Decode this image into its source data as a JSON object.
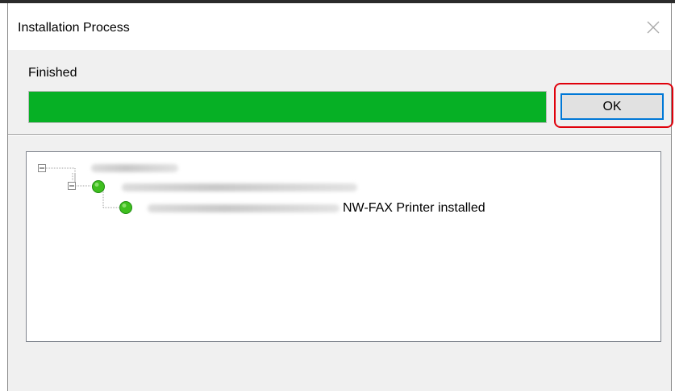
{
  "window": {
    "title": "Installation Process",
    "close_icon": "close-icon"
  },
  "status": {
    "label": "Finished",
    "progress_percent": 100,
    "progress_color": "#06b025"
  },
  "ok_button": {
    "label": "OK",
    "highlight_color": "#e0000b"
  },
  "tree": {
    "items": [
      {
        "level": 0,
        "label": "",
        "obscured": true,
        "expanded": true,
        "icon": "minus-box-icon"
      },
      {
        "level": 1,
        "label": "",
        "obscured": true,
        "expanded": true,
        "icon": "green-status-icon"
      },
      {
        "level": 2,
        "label": "",
        "obscured": true,
        "status": "NW-FAX Printer installed",
        "icon": "green-status-icon"
      }
    ]
  }
}
